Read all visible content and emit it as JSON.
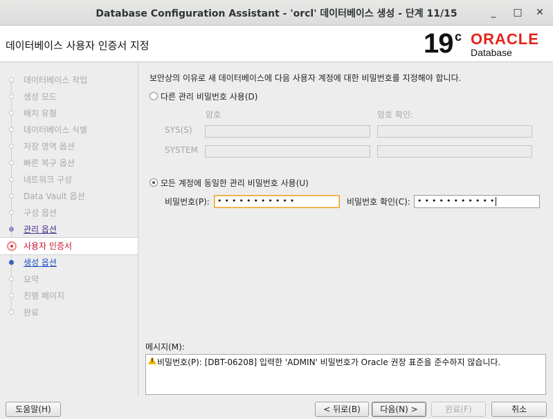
{
  "window": {
    "title": "Database Configuration Assistant - 'orcl' 데이터베이스 생성 - 단계 11/15",
    "minimize_glyph": "_",
    "maximize_glyph": "□",
    "close_glyph": "✕"
  },
  "header": {
    "page_title": "데이터베이스 사용자 인증서 지정",
    "logo_version": "19",
    "logo_suffix": "c",
    "logo_brand": "ORACLE",
    "logo_product": "Database"
  },
  "sidebar": {
    "steps": [
      {
        "label": "데이터베이스 작업",
        "state": "disabled"
      },
      {
        "label": "생성 모드",
        "state": "disabled"
      },
      {
        "label": "배치 유형",
        "state": "disabled"
      },
      {
        "label": "데이터베이스 식별",
        "state": "disabled"
      },
      {
        "label": "저장 영역 옵션",
        "state": "disabled"
      },
      {
        "label": "빠른 복구 옵션",
        "state": "disabled"
      },
      {
        "label": "네트워크 구성",
        "state": "disabled"
      },
      {
        "label": "Data Vault 옵션",
        "state": "disabled"
      },
      {
        "label": "구성 옵션",
        "state": "disabled"
      },
      {
        "label": "관리 옵션",
        "state": "done"
      },
      {
        "label": "사용자 인증서",
        "state": "current"
      },
      {
        "label": "생성 옵션",
        "state": "next"
      },
      {
        "label": "요약",
        "state": "disabled"
      },
      {
        "label": "진행 페이지",
        "state": "disabled"
      },
      {
        "label": "완료",
        "state": "disabled"
      }
    ]
  },
  "main": {
    "intro": "보안상의 이유로 새 데이터베이스에 다음 사용자 계정에 대한 비밀번호를 지정해야 합니다.",
    "option_separate": "다른 관리 비밀번호 사용(D)",
    "col_password": "암호",
    "col_confirm": "암호 확인:",
    "row_sys": "SYS(S)",
    "row_system": "SYSTEM",
    "option_same": "모든 계정에 동일한 관리 비밀번호 사용(U)",
    "password_label": "비밀번호(P):",
    "password_value": "•••••••••••",
    "confirm_label": "비밀번호 확인(C):",
    "confirm_value": "•••••••••••"
  },
  "messages": {
    "label": "메시지(M):",
    "text": "비밀번호(P): [DBT-06208] 입력한 'ADMIN' 비밀번호가 Oracle 권장 표준을 준수하지 않습니다."
  },
  "buttons": {
    "help": "도움말(H)",
    "back": "< 뒤로(B)",
    "next": "다음(N) >",
    "finish": "완료(F)",
    "cancel": "취소"
  }
}
